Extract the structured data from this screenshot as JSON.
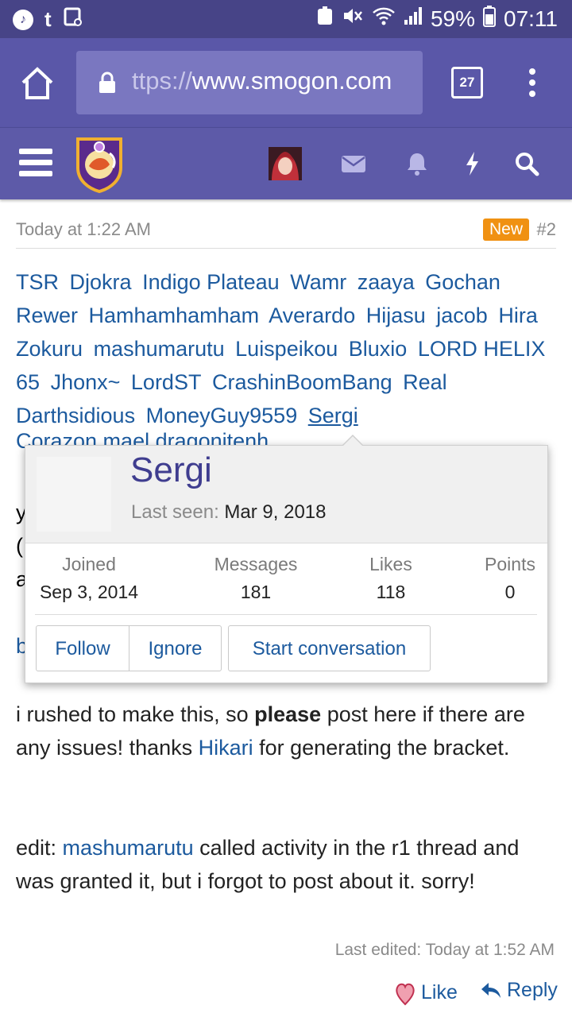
{
  "status_bar": {
    "battery": "59%",
    "time": "07:11"
  },
  "browser": {
    "url_dim": "ttps://",
    "url_main": "www.smogon.com",
    "tab_count": "27"
  },
  "post": {
    "time": "Today at 1:22 AM",
    "new_label": "New",
    "post_number": "#2",
    "names": [
      "TSR",
      "Djokra",
      "Indigo Plateau",
      "Wamr",
      "zaaya",
      "Gochan",
      "Rewer",
      "Hamhamhamham",
      "Averardo",
      "Hijasu",
      "jacob",
      "Hira",
      "Zokuru",
      "mashumarutu",
      "Luispeikou",
      "Bluxio",
      "LORD HELIX 65",
      "Jhonx~",
      "LordST",
      "CrashinBoomBang",
      "Real Darthsidious",
      "MoneyGuy9559",
      "Sergi"
    ],
    "names_partial": "Corazon  mael dragonitenh",
    "line1_a": "i rushed to make this, so ",
    "line1_bold": "please",
    "line1_b": " post here if there are any issues! thanks ",
    "line1_link": "Hikari",
    "line1_c": " for generating the bracket.",
    "edit_prefix": "edit: ",
    "edit_link": "mashumarutu",
    "edit_rest": " called activity in the r1 thread and was granted it, but i forgot to post about it. sorry!",
    "last_edited": "Last edited: Today at 1:52 AM",
    "like_label": "Like",
    "reply_label": "Reply"
  },
  "popup": {
    "username": "Sergi",
    "last_seen_label": "Last seen:",
    "last_seen_value": "Mar 9, 2018",
    "stats": [
      {
        "label": "Joined",
        "value": "Sep 3, 2014"
      },
      {
        "label": "Messages",
        "value": "181"
      },
      {
        "label": "Likes",
        "value": "118"
      },
      {
        "label": "Points",
        "value": "0"
      }
    ],
    "follow_label": "Follow",
    "ignore_label": "Ignore",
    "start_conv_label": "Start conversation"
  },
  "colors": {
    "status_bar": "#474487",
    "browser_bar": "#5a57a8",
    "nav_bar": "#5d5aa8",
    "link": "#1c5a9e",
    "badge": "#f09112"
  }
}
